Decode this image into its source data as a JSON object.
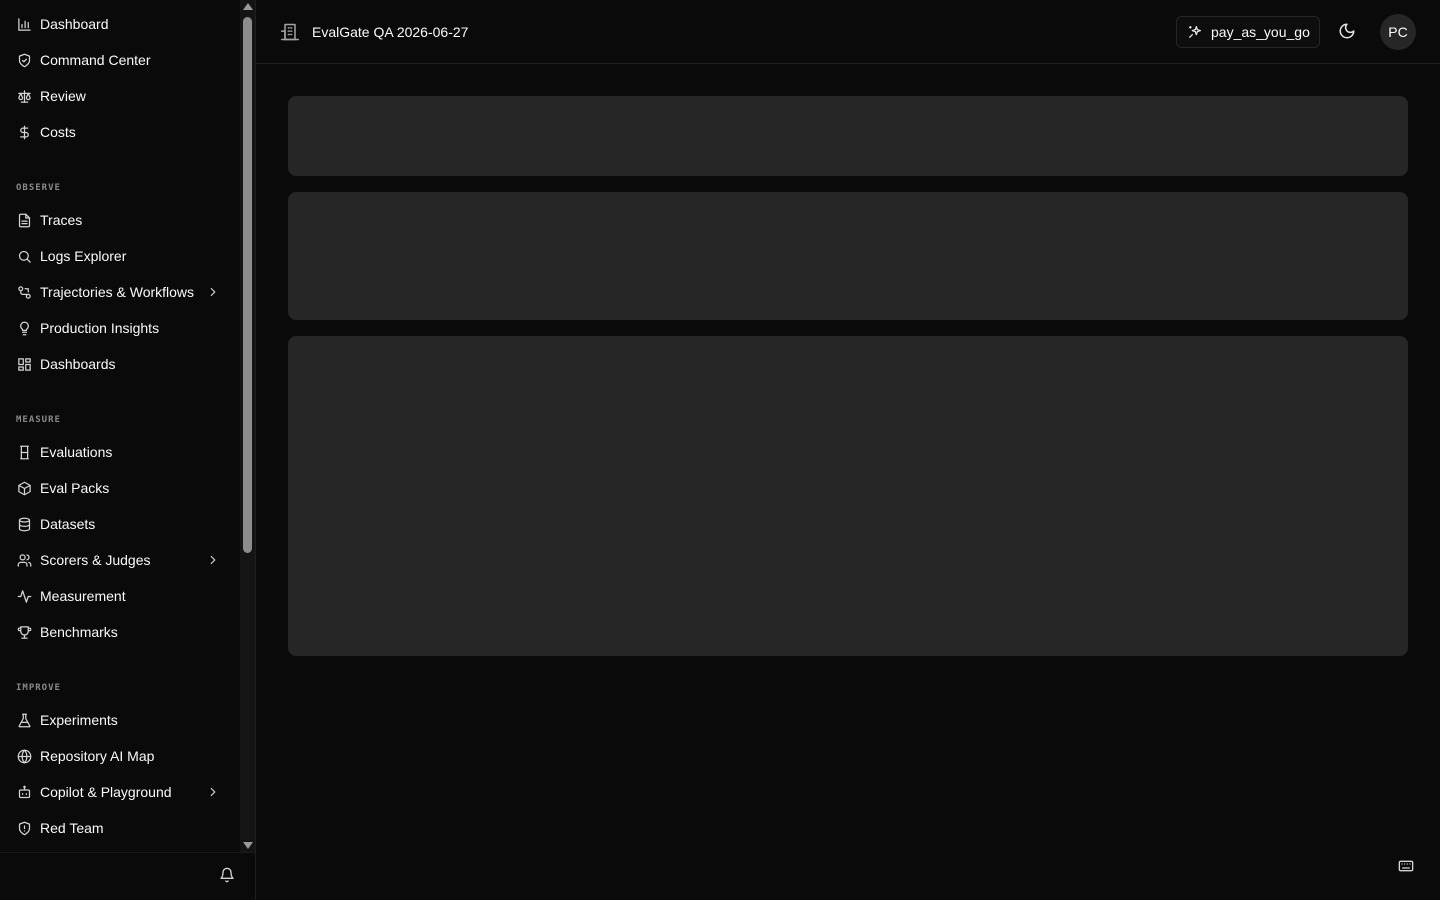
{
  "sidebar": {
    "top_items": [
      {
        "label": "Dashboard",
        "icon": "bar-chart-icon"
      },
      {
        "label": "Command Center",
        "icon": "shield-check-icon"
      },
      {
        "label": "Review",
        "icon": "scale-icon"
      },
      {
        "label": "Costs",
        "icon": "dollar-icon"
      }
    ],
    "observe": {
      "label": "OBSERVE",
      "items": [
        {
          "label": "Traces",
          "icon": "file-text-icon"
        },
        {
          "label": "Logs Explorer",
          "icon": "search-icon"
        },
        {
          "label": "Trajectories & Workflows",
          "icon": "workflow-icon"
        },
        {
          "label": "Production Insights",
          "icon": "lightbulb-icon"
        },
        {
          "label": "Dashboards",
          "icon": "layout-grid-icon"
        }
      ]
    },
    "measure": {
      "label": "MEASURE",
      "items": [
        {
          "label": "Evaluations",
          "icon": "hourglass-icon"
        },
        {
          "label": "Eval Packs",
          "icon": "package-icon"
        },
        {
          "label": "Datasets",
          "icon": "database-icon"
        },
        {
          "label": "Scorers & Judges",
          "icon": "users-icon"
        },
        {
          "label": "Measurement",
          "icon": "activity-icon"
        },
        {
          "label": "Benchmarks",
          "icon": "trophy-icon"
        }
      ]
    },
    "improve": {
      "label": "IMPROVE",
      "items": [
        {
          "label": "Experiments",
          "icon": "flask-icon"
        },
        {
          "label": "Repository AI Map",
          "icon": "globe-icon"
        },
        {
          "label": "Copilot & Playground",
          "icon": "bot-icon"
        },
        {
          "label": "Red Team",
          "icon": "shield-icon"
        }
      ]
    }
  },
  "header": {
    "org_title": "EvalGate QA 2026-06-27",
    "plan_label": "pay_as_you_go",
    "avatar_initials": "PC"
  }
}
